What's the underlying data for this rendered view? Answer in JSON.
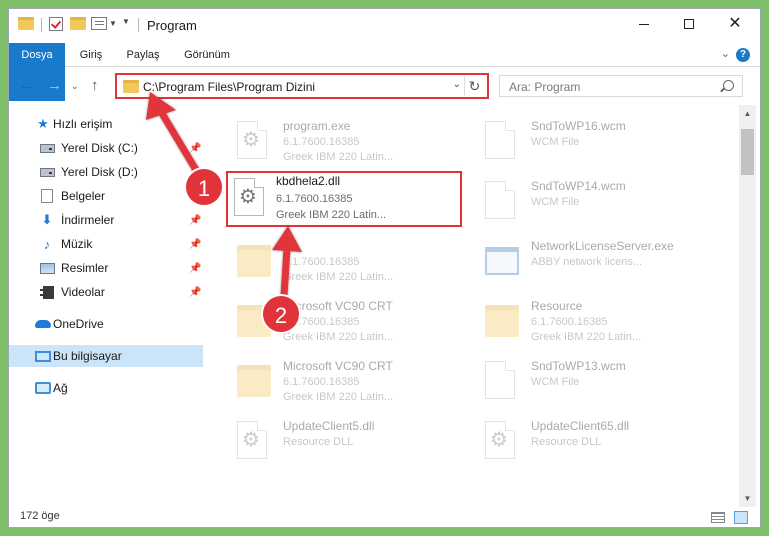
{
  "window": {
    "title": "Program",
    "controls": {
      "minimize": "minimize-icon",
      "maximize": "maximize-icon",
      "close": "close-icon"
    }
  },
  "ribbon": {
    "tabs": [
      "Dosya",
      "Giriş",
      "Paylaş",
      "Görünüm"
    ],
    "active": "Dosya"
  },
  "navigation": {
    "address": "C:\\Program Files\\Program Dizini",
    "search_placeholder": "Ara: Program"
  },
  "sidebar": {
    "items": [
      {
        "label": "Hızlı erişim",
        "icon": "star-icon"
      },
      {
        "label": "Yerel Disk (C:)",
        "icon": "drive-icon",
        "pinned": true
      },
      {
        "label": "Yerel Disk (D:)",
        "icon": "drive-icon",
        "pinned": true
      },
      {
        "label": "Belgeler",
        "icon": "documents-icon",
        "pinned": true
      },
      {
        "label": "İndirmeler",
        "icon": "downloads-icon",
        "pinned": true
      },
      {
        "label": "Müzik",
        "icon": "music-icon",
        "pinned": true
      },
      {
        "label": "Resimler",
        "icon": "pictures-icon",
        "pinned": true
      },
      {
        "label": "Videolar",
        "icon": "videos-icon",
        "pinned": true
      },
      {
        "label": "OneDrive",
        "icon": "onedrive-icon"
      },
      {
        "label": "Bu bilgisayar",
        "icon": "this-pc-icon",
        "selected": true
      },
      {
        "label": "Ağ",
        "icon": "network-icon"
      }
    ]
  },
  "files": {
    "left": [
      {
        "name": "program.exe",
        "line1": "6.1.7600.16385",
        "line2": "Greek IBM 220 Latin...",
        "icon": "exe-gear-icon"
      },
      {
        "name": "kbdhela2.dll",
        "line1": "6.1.7600.16385",
        "line2": "Greek IBM 220 Latin...",
        "icon": "dll-gear-icon",
        "highlighted": true
      },
      {
        "name": "",
        "line1": "6.1.7600.16385",
        "line2": "Greek IBM 220 Latin...",
        "icon": "folder-icon"
      },
      {
        "name": "Microsoft VC90 CRT",
        "line1": "6.1.7600.16385",
        "line2": "Greek IBM 220 Latin...",
        "icon": "folder-icon"
      },
      {
        "name": "Microsoft VC90 CRT",
        "line1": "6.1.7600.16385",
        "line2": "Greek IBM 220 Latin...",
        "icon": "folder-icon"
      },
      {
        "name": "UpdateClient5.dll",
        "line1": "Resource DLL",
        "line2": "",
        "icon": "dll-gear-icon"
      }
    ],
    "right": [
      {
        "name": "SndToWP16.wcm",
        "line1": "WCM File",
        "line2": "",
        "icon": "document-icon"
      },
      {
        "name": "SndToWP14.wcm",
        "line1": "WCM File",
        "line2": "",
        "icon": "document-icon"
      },
      {
        "name": "NetworkLicenseServer.exe",
        "line1": "ABBY network licens...",
        "line2": "",
        "icon": "exe-icon"
      },
      {
        "name": "Resource",
        "line1": "6.1.7600.16385",
        "line2": "Greek IBM 220 Latin...",
        "icon": "folder-icon"
      },
      {
        "name": "SndToWP13.wcm",
        "line1": "WCM File",
        "line2": "",
        "icon": "document-icon"
      },
      {
        "name": "UpdateClient65.dll",
        "line1": "Resource DLL",
        "line2": "",
        "icon": "dll-gear-icon"
      }
    ]
  },
  "annotations": {
    "step1": "1",
    "step2": "2",
    "color": "#e0343a"
  },
  "status": {
    "item_count": "172 öge"
  },
  "colors": {
    "accent": "#1979ca",
    "highlight": "#e0343a",
    "selection": "#cce4f7"
  }
}
